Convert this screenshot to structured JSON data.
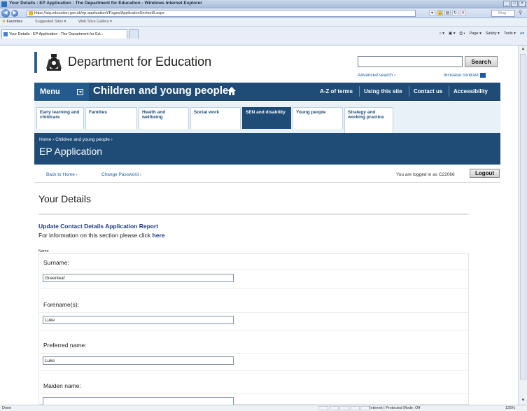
{
  "browser": {
    "window_title": "Your Details : EP Application : The Department for Education - Windows Internet Explorer",
    "url": "https://stq.education.gov.uk/ep-application/i/Pages/ApplicationSectionB.aspx",
    "search_placeholder": "Bing",
    "favorites_label": "Favorites",
    "suggested_sites": "Suggested Sites ▾",
    "web_slice": "Web Slice Gallery ▾",
    "tab_title": "Your Details : EP Application : The Department for Ed...",
    "commands": [
      "Page ▾",
      "Safety ▾",
      "Tools ▾"
    ],
    "status_left": "Done",
    "status_zone": "Internet | Protected Mode: Off",
    "status_zoom": "125%"
  },
  "header": {
    "dept_name": "Department for Education",
    "search_button": "Search",
    "advanced_search": "Advanced search ›",
    "increase_contrast": "Increase contrast"
  },
  "mainnav": {
    "menu": "Menu",
    "section": "Children and young people",
    "links": [
      "A-Z of terms",
      "Using this site",
      "Contact us",
      "Accessibility"
    ]
  },
  "subnav": {
    "tabs": [
      {
        "label": "Early learning and childcare"
      },
      {
        "label": "Families"
      },
      {
        "label": "Health and wellbeing"
      },
      {
        "label": "Social work"
      },
      {
        "label": "SEN and disability"
      },
      {
        "label": "Young people"
      },
      {
        "label": "Strategy and working practice"
      }
    ]
  },
  "band": {
    "breadcrumb": "Home ›  Children and young people ›",
    "title": "EP Application"
  },
  "userbar": {
    "back_home": "Back to Home ›",
    "change_password": "Change Password ›",
    "logged_in": "You are logged in as C22066",
    "logout": "Logout"
  },
  "content": {
    "heading": "Your Details",
    "report_link": "Update Contact Details Application Report",
    "info_text": "For information on this section please click ",
    "info_link": "here",
    "name_label": "Name"
  },
  "form": {
    "fields": [
      {
        "label": "Surname:",
        "value": "Greenleaf"
      },
      {
        "label": "Forename(s):",
        "value": "Luke"
      },
      {
        "label": "Preferred name:",
        "value": "Luke"
      },
      {
        "label": "Maiden name:",
        "value": ""
      }
    ]
  }
}
